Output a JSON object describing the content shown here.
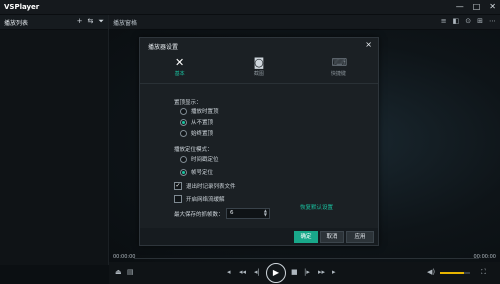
{
  "app": {
    "title": "VSPlayer",
    "win_buttons": [
      "—",
      "□",
      "✕"
    ]
  },
  "left_panel": {
    "title": "播放列表",
    "tools": [
      "+",
      "⇆",
      "⏷"
    ],
    "collapse": "‹"
  },
  "video": {
    "title": "播放窗格",
    "tools": [
      "≡",
      "◧",
      "⊙",
      "⊞",
      "⋯"
    ]
  },
  "dialog": {
    "title": "播放器设置",
    "close": "×",
    "tabs": [
      {
        "label": "基本",
        "icon": "tools-icon",
        "glyph": "✕",
        "active": true
      },
      {
        "label": "截图",
        "icon": "camera-icon",
        "glyph": "◙",
        "active": false
      },
      {
        "label": "快捷键",
        "icon": "keyboard-icon",
        "glyph": "⌨",
        "active": false
      }
    ],
    "msg_label": "置顶显示：",
    "msg_options": [
      {
        "label": "播放时置顶",
        "checked": false
      },
      {
        "label": "从不置顶",
        "checked": true
      },
      {
        "label": "始终置顶",
        "checked": false
      }
    ],
    "locate_label": "播放定位模式：",
    "locate_options": [
      {
        "label": "时间戳定位",
        "checked": false
      },
      {
        "label": "帧号定位",
        "checked": true
      }
    ],
    "checks": [
      {
        "label": "退出时记录列表文件",
        "checked": true
      },
      {
        "label": "开启网络流缓解",
        "checked": false
      }
    ],
    "max_label": "最大保存的抓帧数：",
    "max_value": "6",
    "reset_label": "恢复默认设置",
    "buttons": {
      "ok": "确定",
      "cancel": "取消",
      "apply": "应用"
    }
  },
  "timebar": {
    "start": "00:00:00",
    "end": "00:00:00"
  },
  "controls": {
    "progress_fraction": 0.0,
    "volume_fraction": 0.8
  }
}
